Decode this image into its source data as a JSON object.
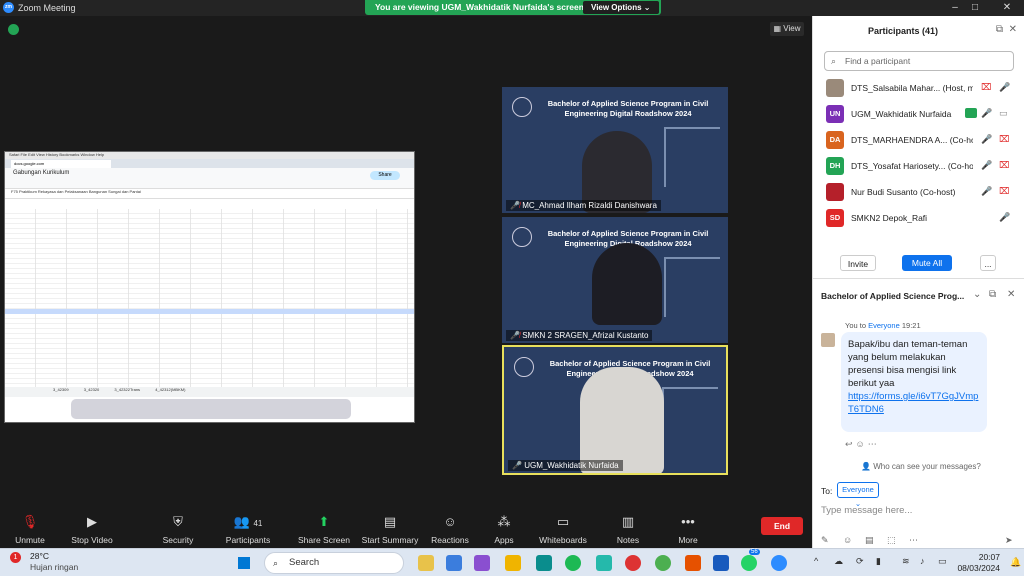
{
  "window": {
    "app_title": "Zoom Meeting",
    "logo_text": "zm"
  },
  "banner": {
    "viewing_text": "You are viewing UGM_Wakhidatik Nurfaida's screen",
    "view_options": "View Options ⌄"
  },
  "stage": {
    "view_label": "View"
  },
  "shared_screen": {
    "doc_title": "Gabungan Kurikulum",
    "share_label": "Share",
    "url": "docs.google.com",
    "sheet_tabs": [
      "3_42309",
      "3_42320",
      "3_42322Trans",
      "4_42312(MBKM)"
    ],
    "formula_bar": "F75  Praktikum Rekayasa dan Pelaksanaan Bangunan Sungai dan Pantai"
  },
  "tiles": [
    {
      "banner": "Bachelor of Applied Science Program in Civil Engineering Digital Roadshow 2024",
      "name": "MC_Ahmad Ilham Rizaldi Danishwara",
      "muted": true
    },
    {
      "banner": "Bachelor of Applied Science Program in Civil Engineering Digital Roadshow 2024",
      "name": "SMKN 2 SRAGEN_Afrizal Kustanto",
      "muted": true
    },
    {
      "banner": "Bachelor of Applied Science Program in Civil Engineering Digital Roadshow 2024",
      "name": "UGM_Wakhidatik Nurfaida",
      "muted": false
    }
  ],
  "toolbar": {
    "unmute": "Unmute",
    "stop_video": "Stop Video",
    "security": "Security",
    "participants": "Participants",
    "participants_count": "41",
    "share_screen": "Share Screen",
    "start_summary": "Start Summary",
    "reactions": "Reactions",
    "apps": "Apps",
    "whiteboards": "Whiteboards",
    "notes": "Notes",
    "more": "More",
    "end": "End"
  },
  "participants_panel": {
    "title": "Participants (41)",
    "search_placeholder": "Find a participant",
    "list": [
      {
        "initials": "",
        "name": "DTS_Salsabila Mahar... (Host, me)",
        "color": "#9a8a7a",
        "mic": "muted",
        "video": "off",
        "sharing": false
      },
      {
        "initials": "UN",
        "name": "UGM_Wakhidatik Nurfaida",
        "color": "#7b2fb5",
        "mic": "on",
        "video": "on",
        "sharing": true
      },
      {
        "initials": "DA",
        "name": "DTS_MARHAENDRA A... (Co-host)",
        "color": "#d9641f",
        "mic": "muted",
        "video": "off",
        "sharing": false
      },
      {
        "initials": "DH",
        "name": "DTS_Yosafat Hariosety... (Co-host)",
        "color": "#23a455",
        "mic": "muted",
        "video": "off",
        "sharing": false
      },
      {
        "initials": "",
        "name": "Nur Budi Susanto (Co-host)",
        "color": "#b5202a",
        "mic": "muted",
        "video": "off",
        "sharing": false
      },
      {
        "initials": "SD",
        "name": "SMKN2 Depok_Rafi",
        "color": "#e02828",
        "mic": "on",
        "video": "none",
        "sharing": false
      }
    ],
    "invite": "Invite",
    "mute_all": "Mute All",
    "more": "..."
  },
  "chat": {
    "title": "Bachelor of Applied Science Prog...",
    "sender_prefix": "You to ",
    "sender_to": "Everyone",
    "time": "19:21",
    "message": "Bapak/ibu dan teman-teman yang belum melakukan presensi bisa mengisi link berikut yaa",
    "link": "https://forms.gle/i6vT7GgJVmpT6TDN6",
    "who_can_see": "Who can see your messages?",
    "to_label": "To:",
    "recipient": "Everyone ⌄",
    "placeholder": "Type message here..."
  },
  "taskbar": {
    "weather_badge": "1",
    "temperature": "28°C",
    "condition": "Hujan ringan",
    "search": "Search",
    "time": "20:07",
    "date": "08/03/2024",
    "badge": "56"
  }
}
